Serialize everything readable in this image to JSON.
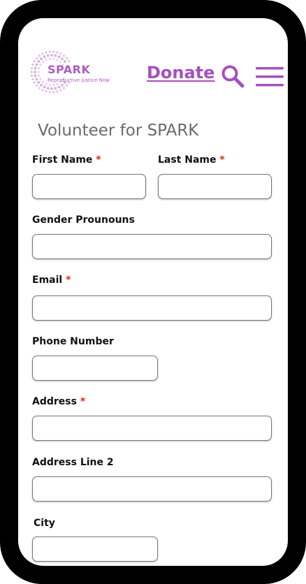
{
  "brand": {
    "name": "SPARK",
    "tagline": "Reproductive Justice Now",
    "accent": "#a64fbf"
  },
  "header": {
    "donate_label": "Donate",
    "search_icon": "search-icon",
    "menu_icon": "hamburger-menu-icon"
  },
  "form": {
    "title": "Volunteer for SPARK",
    "required_marker": "*",
    "fields": {
      "first_name": {
        "label": "First Name",
        "value": ""
      },
      "last_name": {
        "label": "Last Name",
        "value": ""
      },
      "pronouns": {
        "label": "Gender Prounouns",
        "value": ""
      },
      "email": {
        "label": "Email",
        "value": ""
      },
      "phone": {
        "label": "Phone Number",
        "value": ""
      },
      "address": {
        "label": "Address",
        "value": ""
      },
      "address2": {
        "label": "Address Line 2",
        "value": ""
      },
      "city": {
        "label": "City",
        "value": ""
      }
    }
  }
}
